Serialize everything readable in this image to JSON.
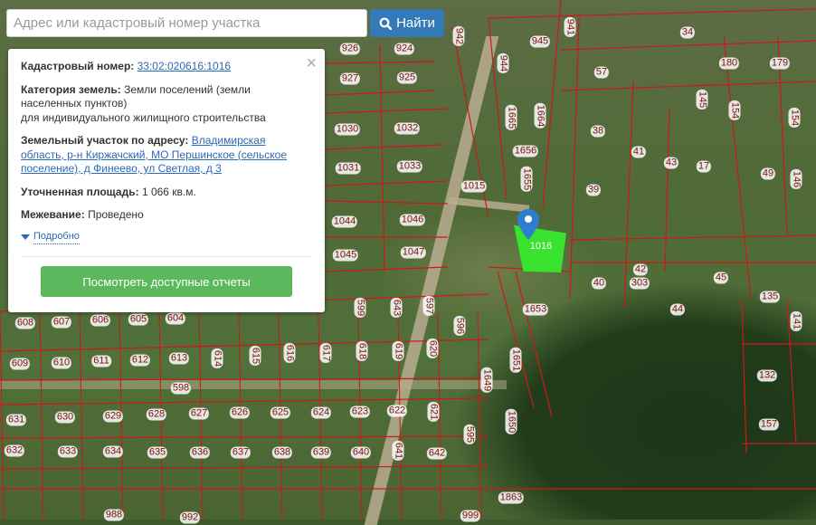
{
  "search": {
    "placeholder": "Адрес или кадастровый номер участка",
    "button_label": "Найти",
    "icon": "search-icon"
  },
  "popup": {
    "cadastral_label": "Кадастровый номер:",
    "cadastral_value": "33:02:020616:1016",
    "category_label": "Категория земель:",
    "category_value": "Земли поселений (земли населенных пунктов)",
    "category_use": "для индивидуального жилищного строительства",
    "address_label": "Земельный участок по адресу:",
    "address_value": "Владимирская область, р-н Киржачский, МО Першинское (сельское поселение), д Финеево, ул Светлая, д 3",
    "area_label": "Уточненная площадь:",
    "area_value": "1 066 кв.м.",
    "survey_label": "Межевание:",
    "survey_value": "Проведено",
    "more_label": "Подробно",
    "reports_button": "Посмотреть доступные отчеты",
    "close": "×"
  },
  "map": {
    "selected_parcel": "1016",
    "parcel_color": "#39e22e",
    "parcel_labels": [
      "926",
      "924",
      "942",
      "945",
      "941",
      "34",
      "927",
      "925",
      "944",
      "57",
      "180",
      "179",
      "1665",
      "1664",
      "145",
      "154",
      "154",
      "38",
      "1030",
      "1032",
      "1656",
      "41",
      "43",
      "17",
      "49",
      "146",
      "1031",
      "1033",
      "1015",
      "1655",
      "39",
      "1044",
      "1046",
      "1045",
      "1047",
      "42",
      "303",
      "45",
      "135",
      "40",
      "44",
      "1653",
      "599",
      "643",
      "597",
      "596",
      "141",
      "608",
      "607",
      "606",
      "605",
      "604",
      "616",
      "617",
      "618",
      "619",
      "620",
      "609",
      "610",
      "611",
      "612",
      "613",
      "614",
      "615",
      "1649",
      "1651",
      "132",
      "598",
      "631",
      "630",
      "629",
      "628",
      "627",
      "626",
      "625",
      "624",
      "623",
      "622",
      "621",
      "1650",
      "595",
      "157",
      "632",
      "633",
      "634",
      "635",
      "636",
      "637",
      "638",
      "639",
      "640",
      "641",
      "642",
      "1863",
      "988",
      "992",
      "999"
    ]
  }
}
